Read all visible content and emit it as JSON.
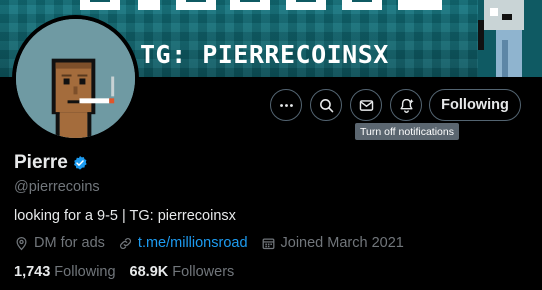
{
  "banner": {
    "tg_text": "TG: PIERRECOINSX",
    "bg_color": "#0f5a63"
  },
  "actions": {
    "more_icon": "more-horizontal-icon",
    "search_icon": "search-icon",
    "message_icon": "envelope-icon",
    "notifications_icon": "bell-icon",
    "follow_label": "Following",
    "tooltip": "Turn off notifications"
  },
  "profile": {
    "display_name": "Pierre",
    "handle": "@pierrecoins",
    "bio": "looking for a 9-5 | TG: pierrecoinsx",
    "location": "DM for ads",
    "website": "t.me/millionsroad",
    "joined": "Joined March 2021",
    "verified_color": "#1d9bf0"
  },
  "stats": {
    "following_count": "1,743",
    "following_label": "Following",
    "followers_count": "68.9K",
    "followers_label": "Followers"
  }
}
